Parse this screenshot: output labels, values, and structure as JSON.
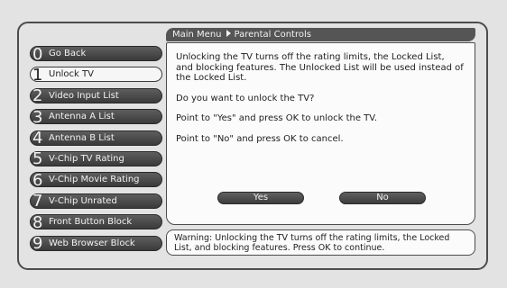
{
  "breadcrumb": {
    "root": "Main Menu",
    "current": "Parental Controls"
  },
  "menu": {
    "items": [
      {
        "num": "0",
        "label": "Go Back"
      },
      {
        "num": "1",
        "label": "Unlock TV",
        "selected": true
      },
      {
        "num": "2",
        "label": "Video Input List"
      },
      {
        "num": "3",
        "label": "Antenna A List"
      },
      {
        "num": "4",
        "label": "Antenna B List"
      },
      {
        "num": "5",
        "label": "V-Chip TV Rating"
      },
      {
        "num": "6",
        "label": "V-Chip Movie Rating"
      },
      {
        "num": "7",
        "label": "V-Chip Unrated"
      },
      {
        "num": "8",
        "label": "Front Button Block"
      },
      {
        "num": "9",
        "label": "Web Browser Block"
      }
    ]
  },
  "dialog": {
    "description": "Unlocking the TV turns off the rating limits, the Locked List, and blocking features. The Unlocked List will be used instead of the Locked List.",
    "question": "Do you want to unlock the TV?",
    "yes_hint": "Point to \"Yes\" and press OK to unlock the TV.",
    "no_hint": "Point to \"No\" and press OK to cancel.",
    "yes_label": "Yes",
    "no_label": "No"
  },
  "warning": {
    "text": "Warning: Unlocking the TV turns off the rating limits, the Locked List, and blocking features. Press OK to continue."
  },
  "colors": {
    "background": "#e3e3e3",
    "button_dark": "#4a4a4a",
    "selected_item": "#f6f6f6",
    "panel_border": "#4c4c4c"
  }
}
